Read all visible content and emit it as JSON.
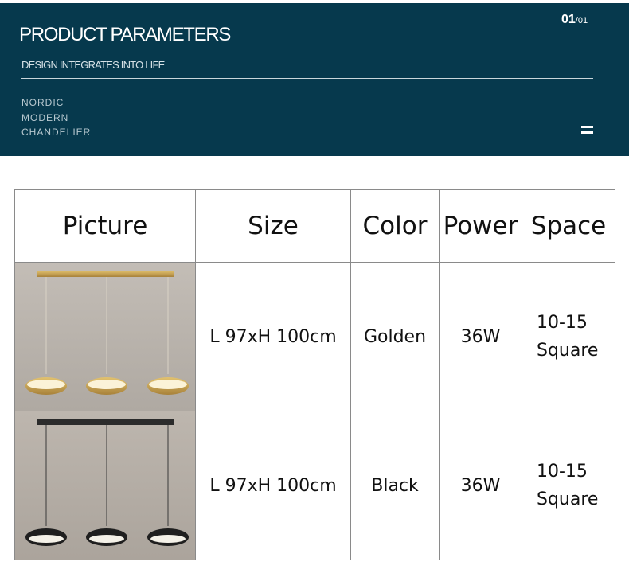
{
  "banner": {
    "title": "PRODUCT PARAMETERS",
    "page_current": "01",
    "page_total": "/01",
    "subtitle": "DESIGN INTEGRATES INTO LIFE",
    "tags": [
      "NORDIC",
      "MODERN",
      "CHANDELIER"
    ],
    "menu_icon": "menu-icon",
    "bg_color": "#06394d"
  },
  "table": {
    "headers": [
      "Picture",
      "Size",
      "Color",
      "Power",
      "Space"
    ],
    "rows": [
      {
        "image": "golden-pendant-lamp-photo",
        "size": "L 97xH 100cm",
        "color": "Golden",
        "power": "36W",
        "space_line1": "10-15",
        "space_line2": "Square"
      },
      {
        "image": "black-pendant-lamp-photo",
        "size": "L 97xH 100cm",
        "color": "Black",
        "power": "36W",
        "space_line1": "10-15",
        "space_line2": "Square"
      }
    ]
  }
}
